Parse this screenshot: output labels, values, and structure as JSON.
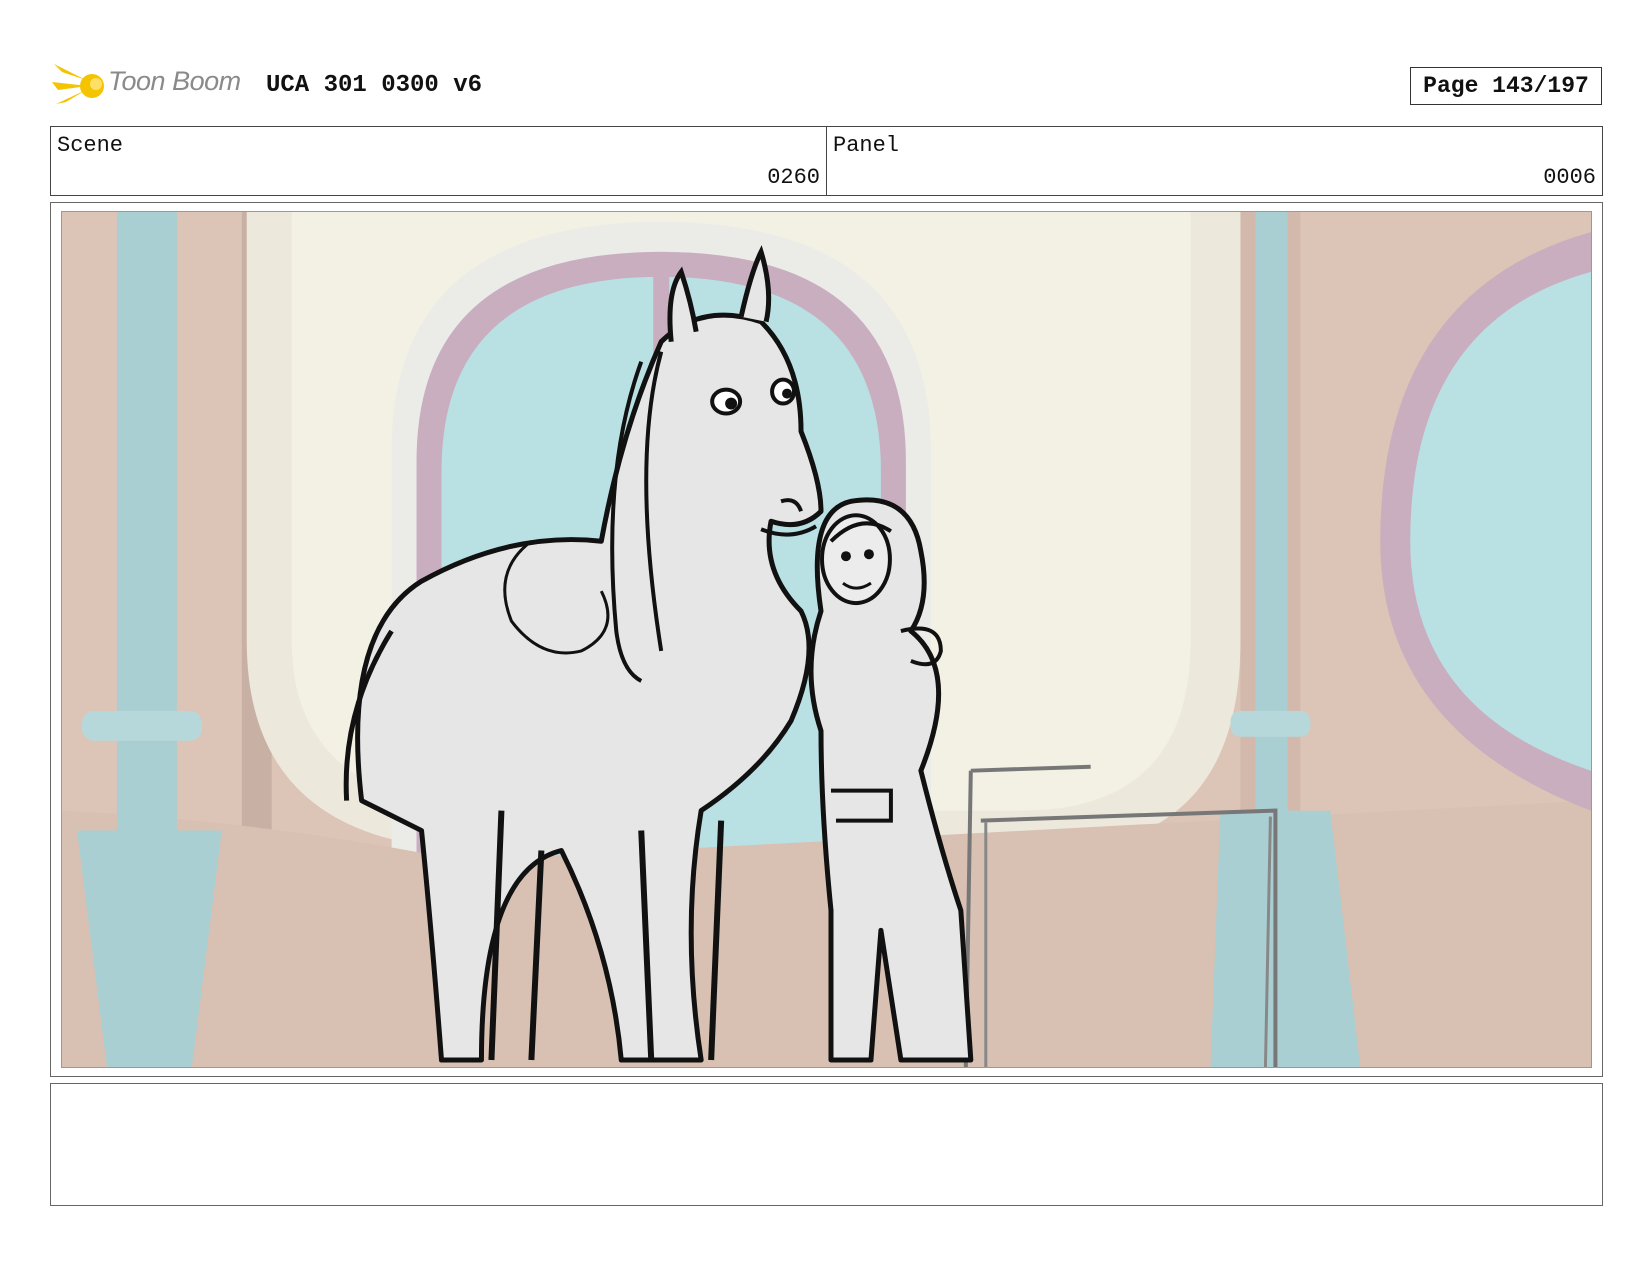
{
  "header": {
    "logo_text": "Toon Boom",
    "doc_title": "UCA 301 0300 v6",
    "page_label": "Page 143/197"
  },
  "info": {
    "scene_label": "Scene",
    "scene_value": "0260",
    "panel_label": "Panel",
    "panel_value": "0006"
  },
  "notes": {
    "text": ""
  },
  "colors": {
    "wall": "#dcc4b6",
    "window_glass": "#b9e0e3",
    "window_frame": "#c9aec0",
    "pillar": "#a9cfd3",
    "logo_yellow": "#f5c400"
  }
}
